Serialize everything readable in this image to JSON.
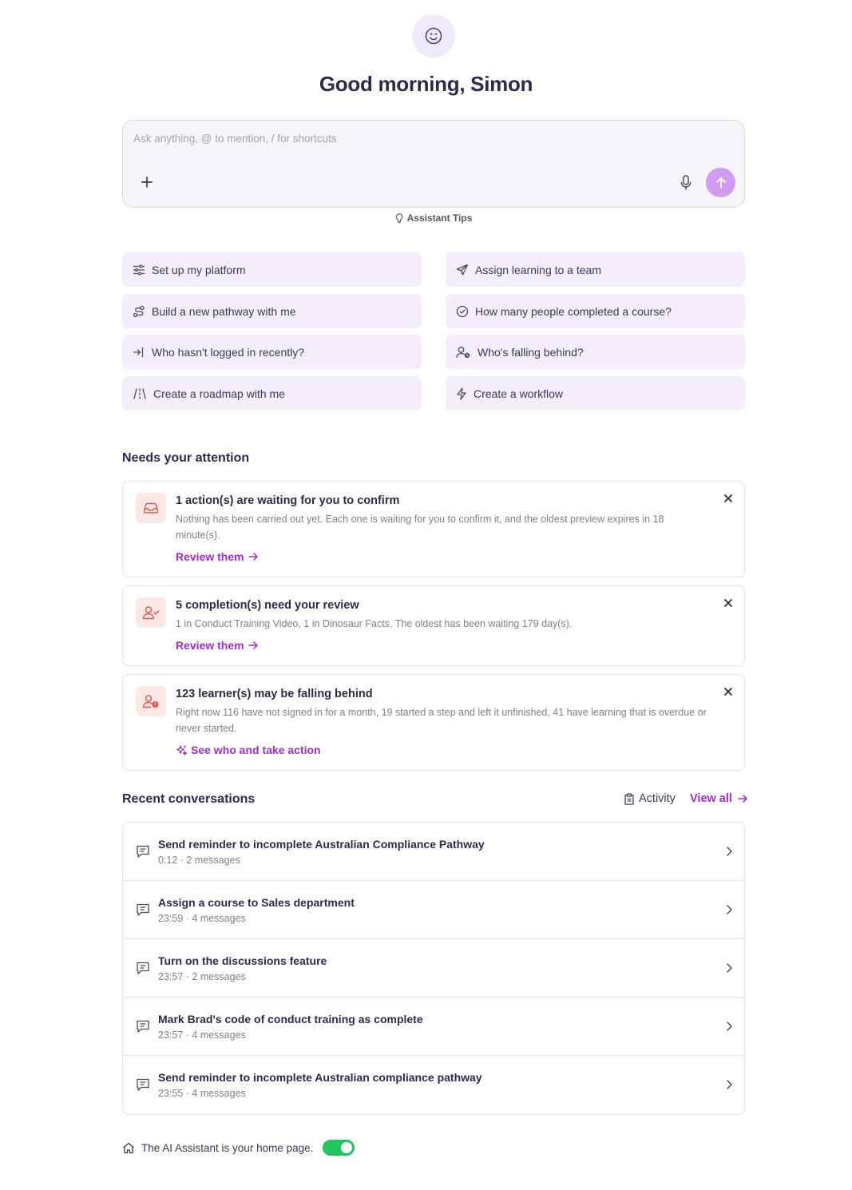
{
  "greeting": "Good morning, Simon",
  "composer": {
    "placeholder": "Ask anything, @ to mention, / for shortcuts",
    "tips_label": "Assistant Tips"
  },
  "quick_actions": {
    "left": [
      {
        "label": "Set up my platform",
        "icon": "sliders-icon"
      },
      {
        "label": "Build a new pathway with me",
        "icon": "route-icon"
      },
      {
        "label": "Who hasn't logged in recently?",
        "icon": "login-icon"
      },
      {
        "label": "Create a roadmap with me",
        "icon": "road-icon"
      }
    ],
    "right": [
      {
        "label": "Assign learning to a team",
        "icon": "send-icon"
      },
      {
        "label": "How many people completed a course?",
        "icon": "check-circle-icon"
      },
      {
        "label": "Who's falling behind?",
        "icon": "user-clock-icon"
      },
      {
        "label": "Create a workflow",
        "icon": "bolt-icon"
      }
    ]
  },
  "attention": {
    "title": "Needs your attention",
    "items": [
      {
        "title": "1 action(s) are waiting for you to confirm",
        "desc": "Nothing has been carried out yet. Each one is waiting for you to confirm it, and the oldest preview expires in 18 minute(s).",
        "link": "Review them",
        "icon": "inbox-icon"
      },
      {
        "title": "5 completion(s) need your review",
        "desc": "1 in Conduct Training Video, 1 in Dinosaur Facts. The oldest has been waiting 179 day(s).",
        "link": "Review them",
        "icon": "user-check-icon"
      },
      {
        "title": "123 learner(s) may be falling behind",
        "desc": "Right now 116 have not signed in for a month, 19 started a step and left it unfinished, 41 have learning that is overdue or never started.",
        "link": "See who and take action",
        "icon": "user-alert-icon"
      }
    ]
  },
  "recent": {
    "title": "Recent conversations",
    "activity_label": "Activity",
    "view_all_label": "View all",
    "items": [
      {
        "title": "Send reminder to incomplete Australian Compliance Pathway",
        "meta": "0:12 · 2 messages"
      },
      {
        "title": "Assign a course to Sales department",
        "meta": "23:59 · 4 messages"
      },
      {
        "title": "Turn on the discussions feature",
        "meta": "23:57 · 2 messages"
      },
      {
        "title": "Mark Brad's code of conduct training as complete",
        "meta": "23:57 · 4 messages"
      },
      {
        "title": "Send reminder to incomplete Australian compliance pathway",
        "meta": "23:55 · 4 messages"
      }
    ]
  },
  "footer": {
    "text": "The AI Assistant is your home page.",
    "toggle_on": true
  },
  "colors": {
    "accent": "#9b2fc8",
    "send_button": "#d19cf0",
    "quick_action_bg": "#f4eefc",
    "alert_icon_bg": "#fde8e6",
    "toggle": "#22c55e"
  }
}
